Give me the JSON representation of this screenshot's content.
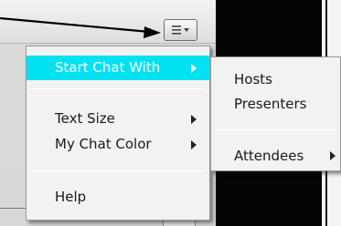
{
  "options_button": {
    "icon": "menu-lines-dropdown-icon"
  },
  "callout": {
    "icon": "arrow-right-icon",
    "color": "#000000"
  },
  "menu": {
    "highlight_color": "#00e2f1",
    "items": [
      {
        "label": "Start Chat With",
        "submenu": true,
        "highlighted": true
      },
      {
        "label": "Text Size",
        "submenu": true
      },
      {
        "label": "My Chat Color",
        "submenu": true
      },
      {
        "label": "Help",
        "submenu": false
      }
    ]
  },
  "submenu": {
    "items": [
      {
        "label": "Hosts",
        "submenu": false
      },
      {
        "label": "Presenters",
        "submenu": false
      },
      {
        "label": "Attendees",
        "submenu": true
      }
    ]
  }
}
